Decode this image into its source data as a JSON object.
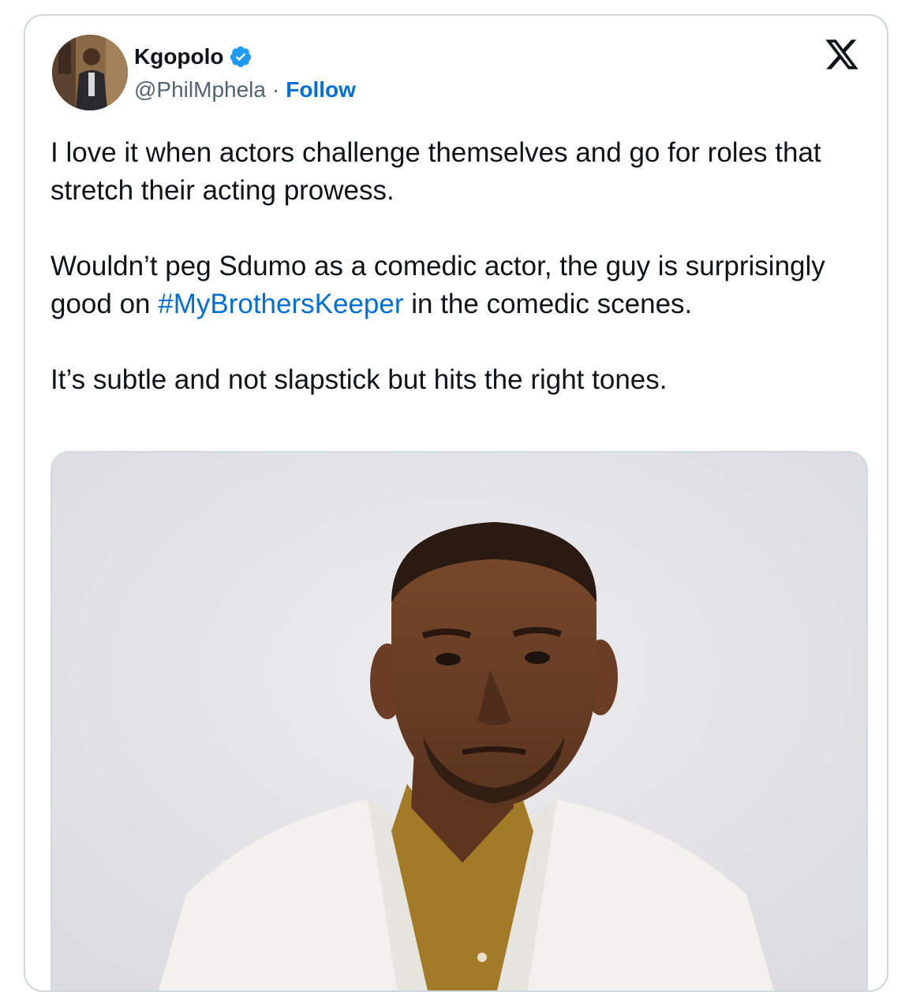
{
  "author": {
    "display_name": "Kgopolo",
    "handle": "@PhilMphela",
    "separator": "·",
    "follow_label": "Follow"
  },
  "tweet": {
    "paragraph_1": "I love it when actors challenge themselves and go for roles that stretch their acting prowess.",
    "paragraph_2_before": "Wouldn’t peg Sdumo as a comedic actor, the guy is surprisingly good on ",
    "hashtag": "#MyBrothersKeeper",
    "paragraph_2_after": " in the comedic scenes.",
    "paragraph_3": "It’s subtle and not slapstick but hits the right tones."
  },
  "icons": {
    "verified": "verified-badge-icon",
    "platform": "x-logo-icon"
  },
  "colors": {
    "link": "#006fd6",
    "verified": "#1d9bf0",
    "text": "#0f1419",
    "muted": "#536471",
    "border": "#cfd9de"
  }
}
